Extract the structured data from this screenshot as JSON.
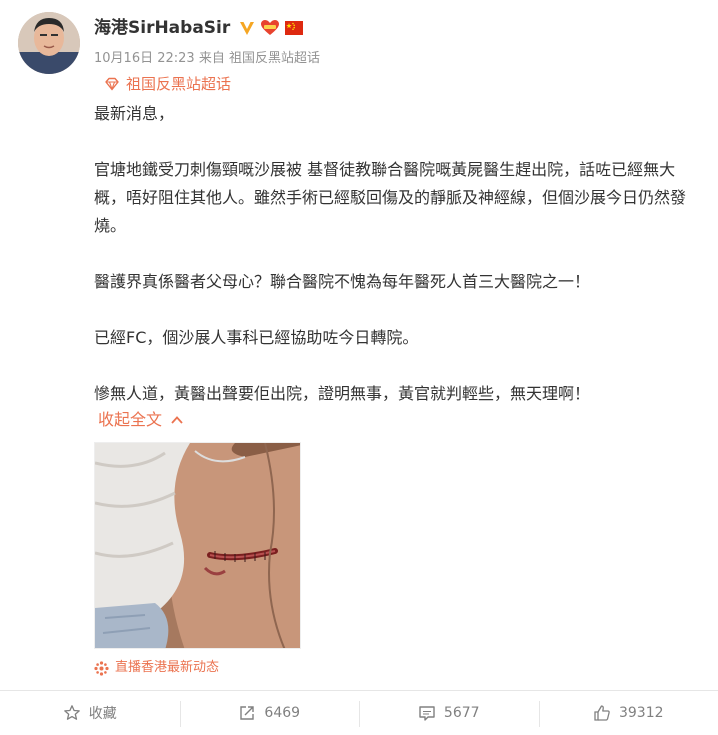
{
  "post": {
    "author": "海港SirHabaSir",
    "verified_icon": "verified-v-icon",
    "flag_icon": "china-flag-icon",
    "timestamp": "10月16日 22:23",
    "source_prefix": "来自",
    "source_name": "祖国反黑站超话",
    "topic": "祖国反黑站超话",
    "paragraphs": [
      "最新消息，",
      "官塘地鐵受刀刺傷頸嘅沙展被 基督徒教聯合醫院嘅黃屍醫生趕出院，話咗已經無大概，唔好阻住其他人。雖然手術已經駁回傷及的靜脈及神經線，但個沙展今日仍然發燒。",
      "醫護界真係醫者父母心？聯合醫院不愧為每年醫死人首三大醫院之一！",
      "已經FC，個沙展人事科已經協助咗今日轉院。",
      "慘無人道，黃醫出聲要佢出院，證明無事，黃官就判輕些，無天理啊！"
    ],
    "collapse_label": "收起全文",
    "image_alt": "neck wound photo",
    "bottom_source": "直播香港最新动态"
  },
  "actions": {
    "favorite_label": "收藏",
    "repost_count": "6469",
    "comment_count": "5677",
    "like_count": "39312"
  },
  "colors": {
    "accent": "#eb7350",
    "meta": "#939393",
    "text": "#333333"
  }
}
